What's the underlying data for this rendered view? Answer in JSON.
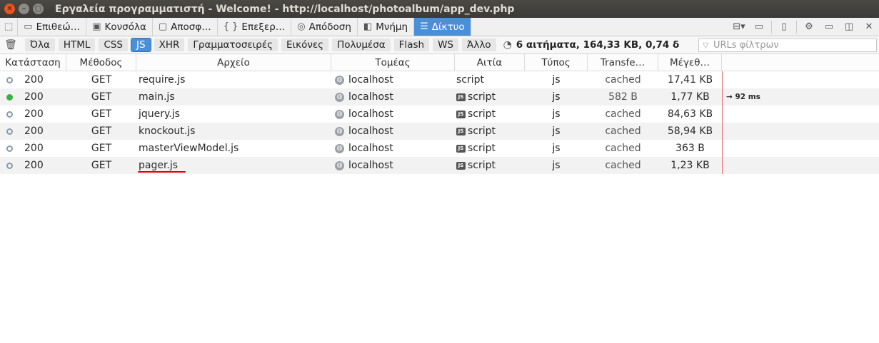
{
  "window": {
    "title": "Εργαλεία προγραμματιστή - Welcome! - http://localhost/photoalbum/app_dev.php"
  },
  "tools": {
    "tabs": [
      {
        "label": "Επιθεώ…",
        "icon": "inspector-icon"
      },
      {
        "label": "Κονσόλα",
        "icon": "console-icon"
      },
      {
        "label": "Αποσφ…",
        "icon": "debugger-icon"
      },
      {
        "label": "Επεξερ…",
        "icon": "style-editor-icon"
      },
      {
        "label": "Απόδοση",
        "icon": "performance-icon"
      },
      {
        "label": "Μνήμη",
        "icon": "memory-icon"
      },
      {
        "label": "Δίκτυο",
        "icon": "network-icon",
        "active": true
      }
    ]
  },
  "filters": {
    "buttons": [
      "Όλα",
      "HTML",
      "CSS",
      "JS",
      "XHR",
      "Γραμματοσειρές",
      "Εικόνες",
      "Πολυμέσα",
      "Flash",
      "WS",
      "Άλλο"
    ],
    "active": "JS",
    "summary": "6 αιτήματα, 164,33 KB, 0,74 δ",
    "url_placeholder": "URLs φίλτρων"
  },
  "table": {
    "headers": {
      "status": "Κατάσταση",
      "method": "Μέθοδος",
      "file": "Αρχείο",
      "domain": "Τομέας",
      "cause": "Αιτία",
      "type": "Τύπος",
      "transferred": "Transfe…",
      "size": "Μέγεθ…"
    },
    "rows": [
      {
        "status": "200",
        "method": "GET",
        "file": "require.js",
        "domain": "localhost",
        "cause": "script",
        "type": "js",
        "transferred": "cached",
        "size": "17,41 KB",
        "waterfall": ""
      },
      {
        "status": "200",
        "method": "GET",
        "file": "main.js",
        "domain": "localhost",
        "cause": "script",
        "type": "js",
        "transferred": "582 B",
        "size": "1,77 KB",
        "waterfall": "→ 92 ms"
      },
      {
        "status": "200",
        "method": "GET",
        "file": "jquery.js",
        "domain": "localhost",
        "cause": "script",
        "type": "js",
        "transferred": "cached",
        "size": "84,63 KB",
        "waterfall": ""
      },
      {
        "status": "200",
        "method": "GET",
        "file": "knockout.js",
        "domain": "localhost",
        "cause": "script",
        "type": "js",
        "transferred": "cached",
        "size": "58,94 KB",
        "waterfall": ""
      },
      {
        "status": "200",
        "method": "GET",
        "file": "masterViewModel.js",
        "domain": "localhost",
        "cause": "script",
        "type": "js",
        "transferred": "cached",
        "size": "363 B",
        "waterfall": ""
      },
      {
        "status": "200",
        "method": "GET",
        "file": "pager.js",
        "domain": "localhost",
        "cause": "script",
        "type": "js",
        "transferred": "cached",
        "size": "1,23 KB",
        "waterfall": ""
      }
    ]
  },
  "colors": {
    "accent": "#4a90d9",
    "status_ok": "#3cb043",
    "annotation": "#e3000f"
  }
}
